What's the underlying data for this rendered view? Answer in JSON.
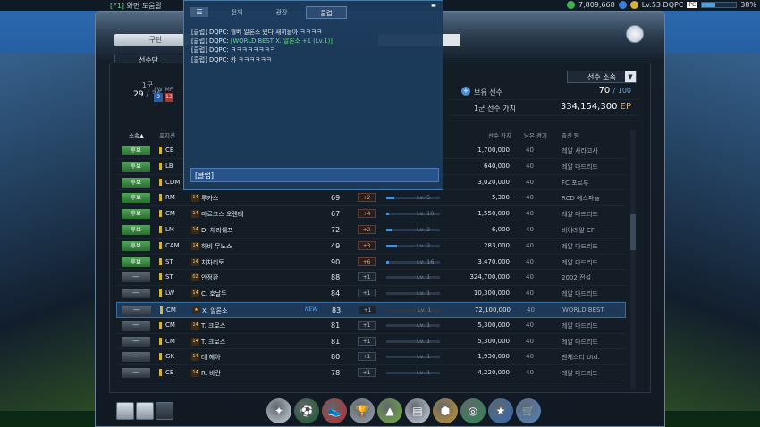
{
  "topbar": {
    "hint_key": "[F1]",
    "hint_text": "화면 도움말",
    "currency_value": "7,809,668",
    "level": "Lv.53 DQPC",
    "pc_badge": "PC",
    "xp_percent": "38%"
  },
  "tabs": {
    "top_tab": "구단",
    "sub_tab": "선수단"
  },
  "squad": {
    "label": "1군",
    "count": "29",
    "total": "/ 36",
    "mini_labels": [
      "FW",
      "MF"
    ],
    "mini_values": [
      "3",
      "13"
    ]
  },
  "filter": {
    "selected": "선수 소속"
  },
  "stats": {
    "owned_label": "보유 선수",
    "owned_value": "70",
    "owned_max": "/ 100",
    "value_label": "1군 선수 가치",
    "value_amount": "334,154,300",
    "value_unit": "EP"
  },
  "table": {
    "headers": {
      "affiliation": "소속▲",
      "position": "포지션",
      "price": "선수 가치",
      "games": "남은 경기",
      "team": "출신 팀"
    },
    "rows": [
      {
        "status": "후보",
        "pos": "CB",
        "card": "",
        "name": "",
        "ovr": "",
        "delta": "",
        "lv": "",
        "price": "1,700,000",
        "games": "40",
        "team": "레알 사라고사",
        "hidden": true
      },
      {
        "status": "후보",
        "pos": "LB",
        "card": "",
        "name": "",
        "ovr": "",
        "delta": "",
        "lv": "",
        "price": "640,000",
        "games": "40",
        "team": "레알 마드리드",
        "hidden": true
      },
      {
        "status": "후보",
        "pos": "CDM",
        "card": "",
        "name": "",
        "ovr": "",
        "delta": "",
        "lv": "",
        "price": "3,020,000",
        "games": "40",
        "team": "FC 포르투",
        "hidden": true
      },
      {
        "status": "후보",
        "pos": "RM",
        "card": "14",
        "name": "루카스",
        "ovr": "69",
        "delta": "+2",
        "lv": "Lv. 5",
        "price": "5,300",
        "games": "40",
        "team": "RCD 에스파뇰",
        "lvfill": 0.15
      },
      {
        "status": "후보",
        "pos": "CM",
        "card": "14",
        "name": "마르코스 오렌테",
        "ovr": "67",
        "delta": "+4",
        "lv": "Lv. 10",
        "price": "1,550,000",
        "games": "40",
        "team": "레알 마드리드",
        "lvfill": 0.05
      },
      {
        "status": "후보",
        "pos": "LM",
        "card": "14",
        "name": "D. 체리쉐프",
        "ovr": "72",
        "delta": "+2",
        "lv": "Lv. 2",
        "price": "6,000",
        "games": "40",
        "team": "비야레알 CF",
        "lvfill": 0.1
      },
      {
        "status": "후보",
        "pos": "CAM",
        "card": "14",
        "name": "하비 무노스",
        "ovr": "49",
        "delta": "+3",
        "lv": "Lv. 2",
        "price": "283,000",
        "games": "40",
        "team": "레알 마드리드",
        "lvfill": 0.2
      },
      {
        "status": "후보",
        "pos": "ST",
        "card": "14",
        "name": "치차리토",
        "ovr": "90",
        "delta": "+6",
        "lv": "Lv. 16",
        "price": "3,470,000",
        "games": "40",
        "team": "레알 마드리드",
        "lvfill": 0.05
      },
      {
        "status": "—",
        "pos": "ST",
        "card": "02",
        "name": "안정환",
        "ovr": "88",
        "delta": "+1",
        "lv": "Lv. 1",
        "price": "324,700,000",
        "games": "40",
        "team": "2002 전설",
        "plain": true,
        "lvfill": 0
      },
      {
        "status": "—",
        "pos": "LW",
        "card": "14",
        "name": "C. 호날두",
        "ovr": "84",
        "delta": "+1",
        "lv": "Lv. 1",
        "price": "10,300,000",
        "games": "40",
        "team": "레알 마드리드",
        "plain": true,
        "lvfill": 0
      },
      {
        "status": "—",
        "pos": "CM",
        "card": "★",
        "name": "X. 알론소",
        "new": "NEW",
        "ovr": "83",
        "delta": "+1",
        "lv": "Lv. 1",
        "price": "72,100,000",
        "games": "40",
        "team": "WORLD BEST",
        "plain": true,
        "selected": true,
        "lvfill": 0
      },
      {
        "status": "—",
        "pos": "CM",
        "card": "14",
        "name": "T. 크로스",
        "ovr": "81",
        "delta": "+1",
        "lv": "Lv. 1",
        "price": "5,300,000",
        "games": "40",
        "team": "레알 마드리드",
        "plain": true,
        "lvfill": 0
      },
      {
        "status": "—",
        "pos": "CM",
        "card": "14",
        "name": "T. 크로스",
        "ovr": "81",
        "delta": "+1",
        "lv": "Lv. 1",
        "price": "5,300,000",
        "games": "40",
        "team": "레알 마드리드",
        "plain": true,
        "lvfill": 0
      },
      {
        "status": "—",
        "pos": "GK",
        "card": "14",
        "name": "데 헤아",
        "ovr": "80",
        "delta": "+1",
        "lv": "Lv. 1",
        "price": "1,930,000",
        "games": "40",
        "team": "맨체스터 Utd.",
        "plain": true,
        "lvfill": 0
      },
      {
        "status": "—",
        "pos": "CB",
        "card": "14",
        "name": "R. 바란",
        "ovr": "78",
        "delta": "+1",
        "lv": "Lv. 1",
        "price": "4,220,000",
        "games": "40",
        "team": "레알 마드리드",
        "plain": true,
        "lvfill": 0
      }
    ]
  },
  "chat": {
    "tabs": [
      "전체",
      "광장",
      "클럽"
    ],
    "active_tab": 2,
    "messages": [
      {
        "text": "[클럽] DQPC: 월베 알론소 떴다 새끼들아 ㅋㅋㅋㅋ",
        "green": false
      },
      {
        "prefix": "[클럽] DQPC: ",
        "text": "[WORLD BEST X. 알론소 +1 (Lv.1)]",
        "green": true
      },
      {
        "text": "[클럽] DQPC: ㅋㅋㅋㅋㅋㅋㅋㅋ",
        "green": false
      },
      {
        "text": "[클럽] DQPC: 캬 ㅋㅋㅋㅋㅋㅋ",
        "green": false
      }
    ],
    "input_value": "[클럽]"
  },
  "colors": {
    "accent": "#4a8fd0",
    "sub_green": "#3c8a44",
    "ep": "#f2a54a",
    "chat_green": "#5ee374"
  },
  "dock_icons": [
    "whistle-icon",
    "ball-icon",
    "boots-icon",
    "trophy-icon",
    "cone-icon",
    "cards-icon",
    "badge-icon",
    "club-icon",
    "star-ball-icon",
    "shop-icon"
  ]
}
